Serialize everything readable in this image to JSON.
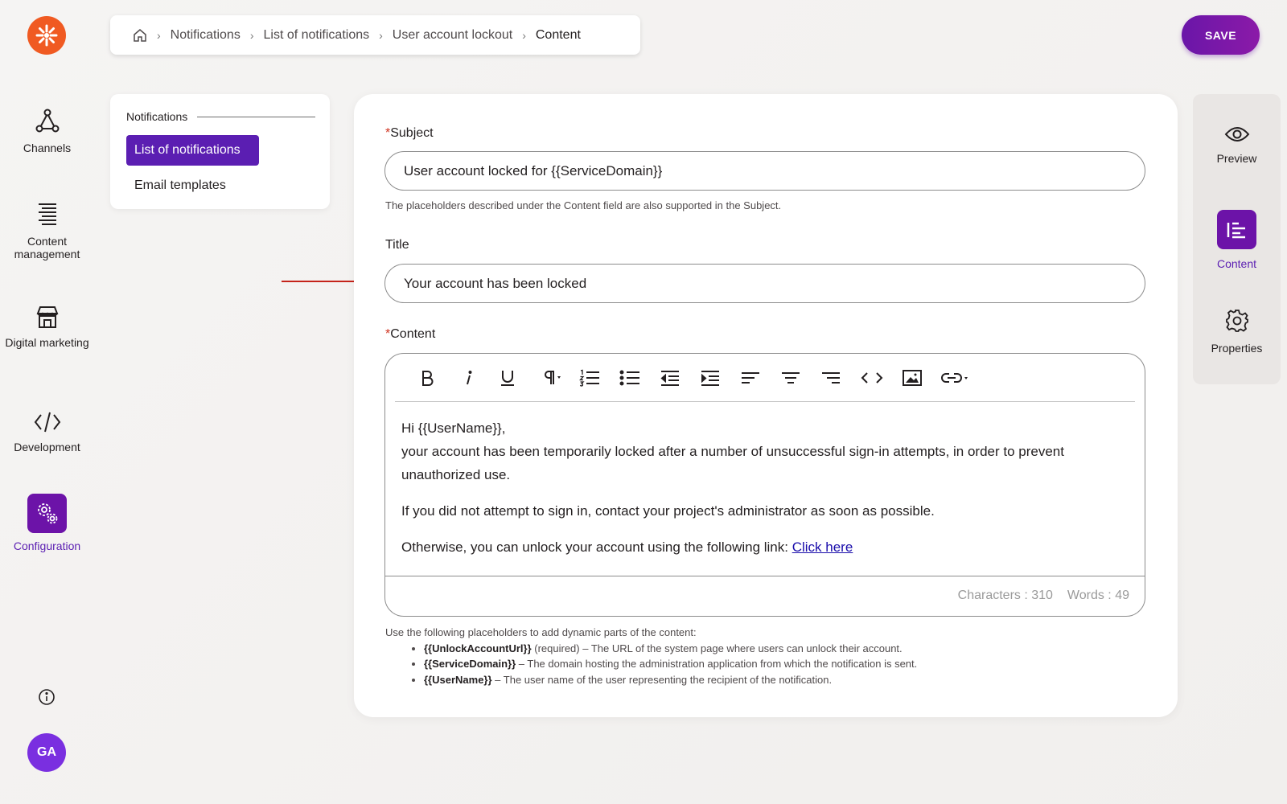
{
  "colors": {
    "brand_orange": "#f05a22",
    "accent_purple": "#5b1eb2",
    "save_button": "#6a16a8",
    "required_marker": "#d0321f",
    "annotation_arrow": "#c4231a"
  },
  "left_nav": {
    "logo": "kentico-logo-icon",
    "items": [
      {
        "label": "Channels",
        "icon": "channels-icon"
      },
      {
        "label": "Content management",
        "icon": "content-management-icon"
      },
      {
        "label": "Digital marketing",
        "icon": "digital-marketing-icon"
      },
      {
        "label": "Development",
        "icon": "development-icon"
      },
      {
        "label": "Configuration",
        "icon": "configuration-icon",
        "active": true
      }
    ],
    "info_icon": "info-icon",
    "avatar_initials": "GA"
  },
  "breadcrumb": {
    "home_icon": "home-icon",
    "items": [
      "Notifications",
      "List of notifications",
      "User account lockout",
      "Content"
    ]
  },
  "save_button": "SAVE",
  "subnav": {
    "heading": "Notifications",
    "items": [
      "List of notifications",
      "Email templates"
    ]
  },
  "form": {
    "subject": {
      "required_mark": "*",
      "label": "Subject",
      "value": "User account locked for {{ServiceDomain}}",
      "hint": "The placeholders described under the Content field are also supported in the Subject."
    },
    "title": {
      "label": "Title",
      "value": "Your account has been locked"
    },
    "content": {
      "required_mark": "*",
      "label": "Content",
      "paragraph1_line1": "Hi {{UserName}},",
      "paragraph1_line2": "your account has been temporarily locked after a number of unsuccessful sign-in attempts, in order to prevent unauthorized use.",
      "paragraph2": "If you did not attempt to sign in, contact your project's administrator as soon as possible.",
      "paragraph3_text": "Otherwise, you can unlock your account using the following link: ",
      "paragraph3_link": "Click here",
      "characters": "Characters : 310",
      "words": "Words : 49"
    },
    "toolbar": [
      "bold-icon",
      "italic-icon",
      "underline-icon",
      "paragraph-format-icon",
      "ordered-list-icon",
      "unordered-list-icon",
      "outdent-icon",
      "indent-icon",
      "align-left-icon",
      "align-center-icon",
      "align-right-icon",
      "code-view-icon",
      "insert-image-icon",
      "insert-link-icon"
    ],
    "placeholder_help": {
      "intro": "Use the following placeholders to add dynamic parts of the content:",
      "items": [
        {
          "name": "{{UnlockAccountUrl}}",
          "text": " (required) – The URL of the system page where users can unlock their account."
        },
        {
          "name": "{{ServiceDomain}}",
          "text": " – The domain hosting the administration application from which the notification is sent."
        },
        {
          "name": "{{UserName}}",
          "text": " – The user name of the user representing the recipient of the notification."
        }
      ]
    }
  },
  "right_nav": {
    "items": [
      {
        "label": "Preview",
        "icon": "eye-icon"
      },
      {
        "label": "Content",
        "icon": "content-icon",
        "active": true
      },
      {
        "label": "Properties",
        "icon": "gear-icon"
      }
    ]
  }
}
